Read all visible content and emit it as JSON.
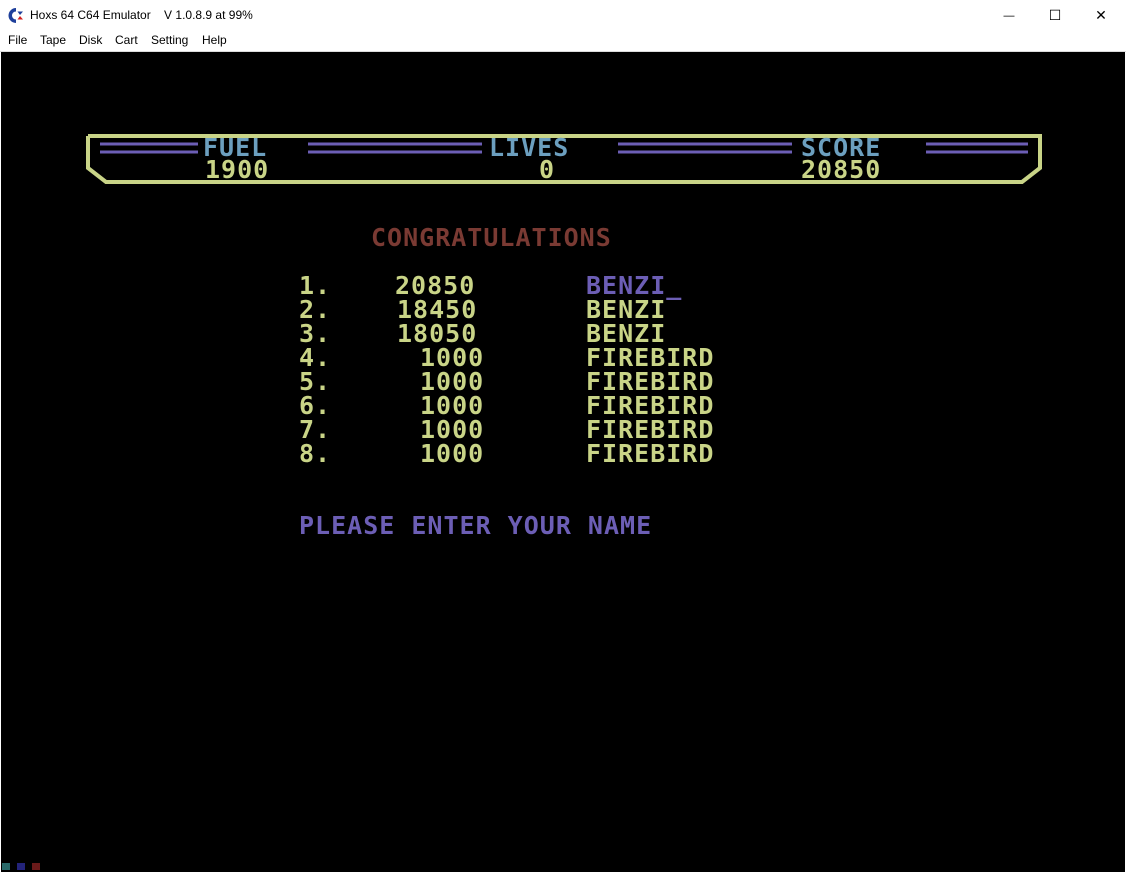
{
  "window": {
    "title": "Hoxs 64 C64 Emulator    V 1.0.8.9 at 99%",
    "minimize_glyph": "—",
    "maximize_glyph": "☐",
    "close_glyph": "✕"
  },
  "menu": [
    "File",
    "Tape",
    "Disk",
    "Cart",
    "Setting",
    "Help"
  ],
  "hud": {
    "fuel_label": "FUEL",
    "fuel_value": "1900",
    "lives_label": "LIVES",
    "lives_value": "0",
    "score_label": "SCORE",
    "score_value": "20850"
  },
  "congrats": "CONGRATULATIONS",
  "highscores": [
    {
      "rank": "1.",
      "score": "20850",
      "name": "BENZI_"
    },
    {
      "rank": "2.",
      "score": "18450",
      "name": "BENZI"
    },
    {
      "rank": "3.",
      "score": "18050",
      "name": "BENZI"
    },
    {
      "rank": "4.",
      "score": "1000",
      "name": "FIREBIRD"
    },
    {
      "rank": "5.",
      "score": "1000",
      "name": "FIREBIRD"
    },
    {
      "rank": "6.",
      "score": "1000",
      "name": "FIREBIRD"
    },
    {
      "rank": "7.",
      "score": "1000",
      "name": "FIREBIRD"
    },
    {
      "rank": "8.",
      "score": "1000",
      "name": "FIREBIRD"
    }
  ],
  "prompt": "PLEASE ENTER YOUR NAME",
  "colors": {
    "yellow": "#c9d487",
    "cyan": "#6c9fbf",
    "purple": "#6c5eb5",
    "brown": "#7a3a33",
    "screen": "#000000"
  }
}
